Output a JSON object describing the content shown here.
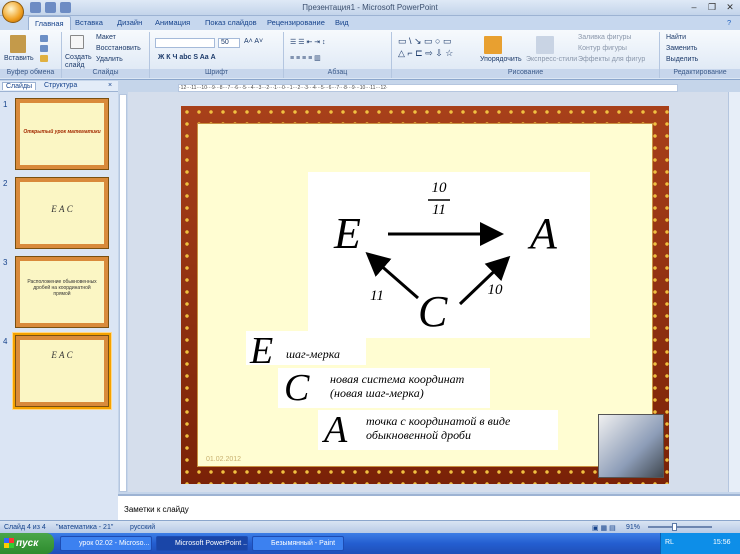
{
  "window": {
    "title": "Презентация1 - Microsoft PowerPoint"
  },
  "ribbon": {
    "tabs": [
      "Главная",
      "Вставка",
      "Дизайн",
      "Анимация",
      "Показ слайдов",
      "Рецензирование",
      "Вид"
    ],
    "clipboard": {
      "paste": "Вставить",
      "group": "Буфер обмена"
    },
    "slides": {
      "new_slide": "Создать слайд",
      "layout": "Макет",
      "reset": "Восстановить",
      "delete": "Удалить",
      "group": "Слайды"
    },
    "font": {
      "size": "50",
      "group": "Шрифт"
    },
    "paragraph": {
      "group": "Абзац"
    },
    "drawing": {
      "arrange": "Упорядочить",
      "quick_styles": "Экспресс-стили",
      "fill": "Заливка фигуры",
      "outline": "Контур фигуры",
      "effects": "Эффекты для фигур",
      "group": "Рисование"
    },
    "editing": {
      "find": "Найти",
      "replace": "Заменить",
      "select": "Выделить",
      "group": "Редактирование"
    }
  },
  "panel": {
    "tab_slides": "Слайды",
    "tab_outline": "Структура"
  },
  "thumbnails": [
    {
      "num": "1",
      "text": "Открытый урок математики"
    },
    {
      "num": "2",
      "text": "Е  А  С"
    },
    {
      "num": "3",
      "text": "Расположение обыкновенных дробей на координатной прямой"
    },
    {
      "num": "4",
      "text": "E  A  C"
    }
  ],
  "ruler_text": "·12···11···10···9···8···7···6···5···4···3···2···1···0···1···2···3···4···5···6···7···8···9···10···11···12·",
  "slide": {
    "letters": {
      "E": "E",
      "A": "A",
      "C": "C"
    },
    "frac_num": "10",
    "frac_den": "11",
    "label_ce": "11",
    "label_ca": "10",
    "legend": [
      {
        "letter": "E",
        "text": "шаг-мерка"
      },
      {
        "letter": "C",
        "text": "новая система координат\n(новая шаг-мерка)"
      },
      {
        "letter": "A",
        "text": "точка с координатой в виде\nобыкновенной дроби"
      }
    ],
    "footer_date": "01.02.2012"
  },
  "notes": {
    "placeholder": "Заметки к слайду"
  },
  "status": {
    "slide": "Слайд 4 из 4",
    "theme": "\"математика - 21\"",
    "lang": "русский",
    "zoom": "91%"
  },
  "taskbar": {
    "start": "пуск",
    "items": [
      "урок 02.02 - Microso...",
      "Microsoft PowerPoint ...",
      "Безымянный - Paint"
    ],
    "clock": "15:56",
    "lang": "RL"
  }
}
